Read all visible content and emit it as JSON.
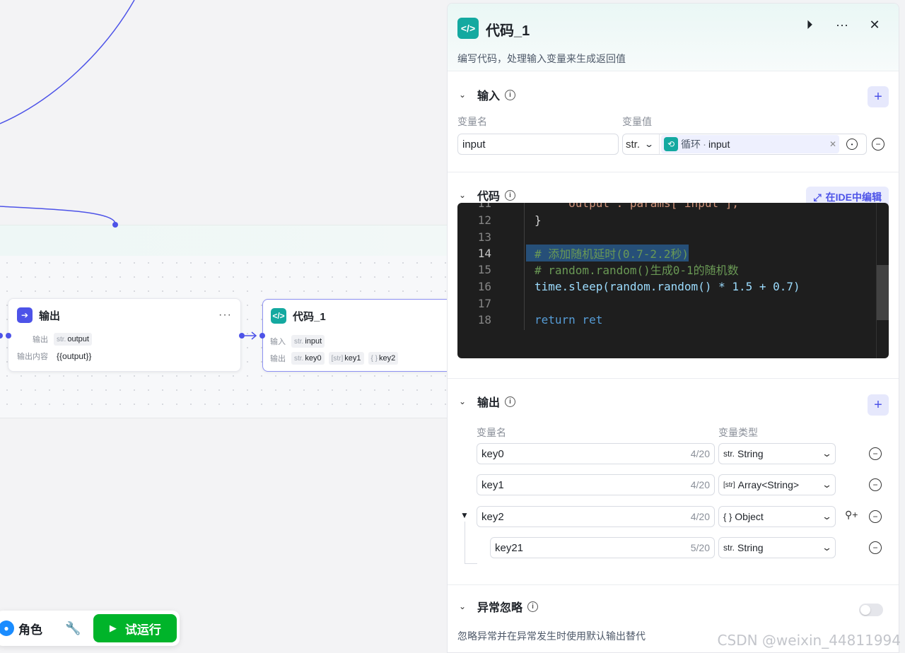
{
  "canvas": {
    "output_node": {
      "title": "输出",
      "more": "···",
      "row1_label": "输出",
      "row1_type": "str.",
      "row1_value": "output",
      "row2_label": "输出内容",
      "row2_value": "{{output}}"
    },
    "code_node": {
      "title": "代码_1",
      "in_label": "输入",
      "in_type": "str.",
      "in_value": "input",
      "out_label": "输出",
      "outs": [
        {
          "type": "str.",
          "name": "key0"
        },
        {
          "type": "[str]",
          "name": "key1"
        },
        {
          "type": "{ }",
          "name": "key2"
        }
      ]
    }
  },
  "toolbar": {
    "role_label": "角色",
    "run_label": "试运行"
  },
  "panel": {
    "title": "代码_1",
    "description": "编写代码，处理输入变量来生成返回值",
    "input_section": {
      "title": "输入",
      "col_name": "变量名",
      "col_value": "变量值",
      "var_name": "input",
      "var_type": "str.",
      "ref_source": "循环",
      "ref_sep": "·",
      "ref_var": "input"
    },
    "code_section": {
      "title": "代码",
      "ide_button": "在IDE中编辑",
      "lines": [
        {
          "n": "11",
          "text": "    \"output\": params['input'],"
        },
        {
          "n": "12",
          "text": "}"
        },
        {
          "n": "13",
          "text": ""
        },
        {
          "n": "14",
          "text": "# 添加随机延时(0.7-2.2秒)"
        },
        {
          "n": "15",
          "text": "# random.random()生成0-1的随机数"
        },
        {
          "n": "16",
          "text": "time.sleep(random.random() * 1.5 + 0.7)"
        },
        {
          "n": "17",
          "text": ""
        },
        {
          "n": "18",
          "text": "return ret"
        }
      ]
    },
    "output_section": {
      "title": "输出",
      "col_name": "变量名",
      "col_type": "变量类型",
      "rows": [
        {
          "name": "key0",
          "count": "4/20",
          "type_icon": "str.",
          "type": "String"
        },
        {
          "name": "key1",
          "count": "4/20",
          "type_icon": "[str]",
          "type": "Array<String>"
        },
        {
          "name": "key2",
          "count": "4/20",
          "type_icon": "{ }",
          "type": "Object"
        },
        {
          "name": "key21",
          "count": "5/20",
          "type_icon": "str.",
          "type": "String"
        }
      ]
    },
    "exception_section": {
      "title": "异常忽略",
      "description": "忽略异常并在异常发生时使用默认输出替代",
      "enabled": false
    }
  },
  "watermark": "CSDN @weixin_44811994",
  "colors": {
    "accent": "#4d53e8",
    "code_node": "#14a9a0",
    "run_button": "#00b42a",
    "edge": "#4d53e8"
  }
}
